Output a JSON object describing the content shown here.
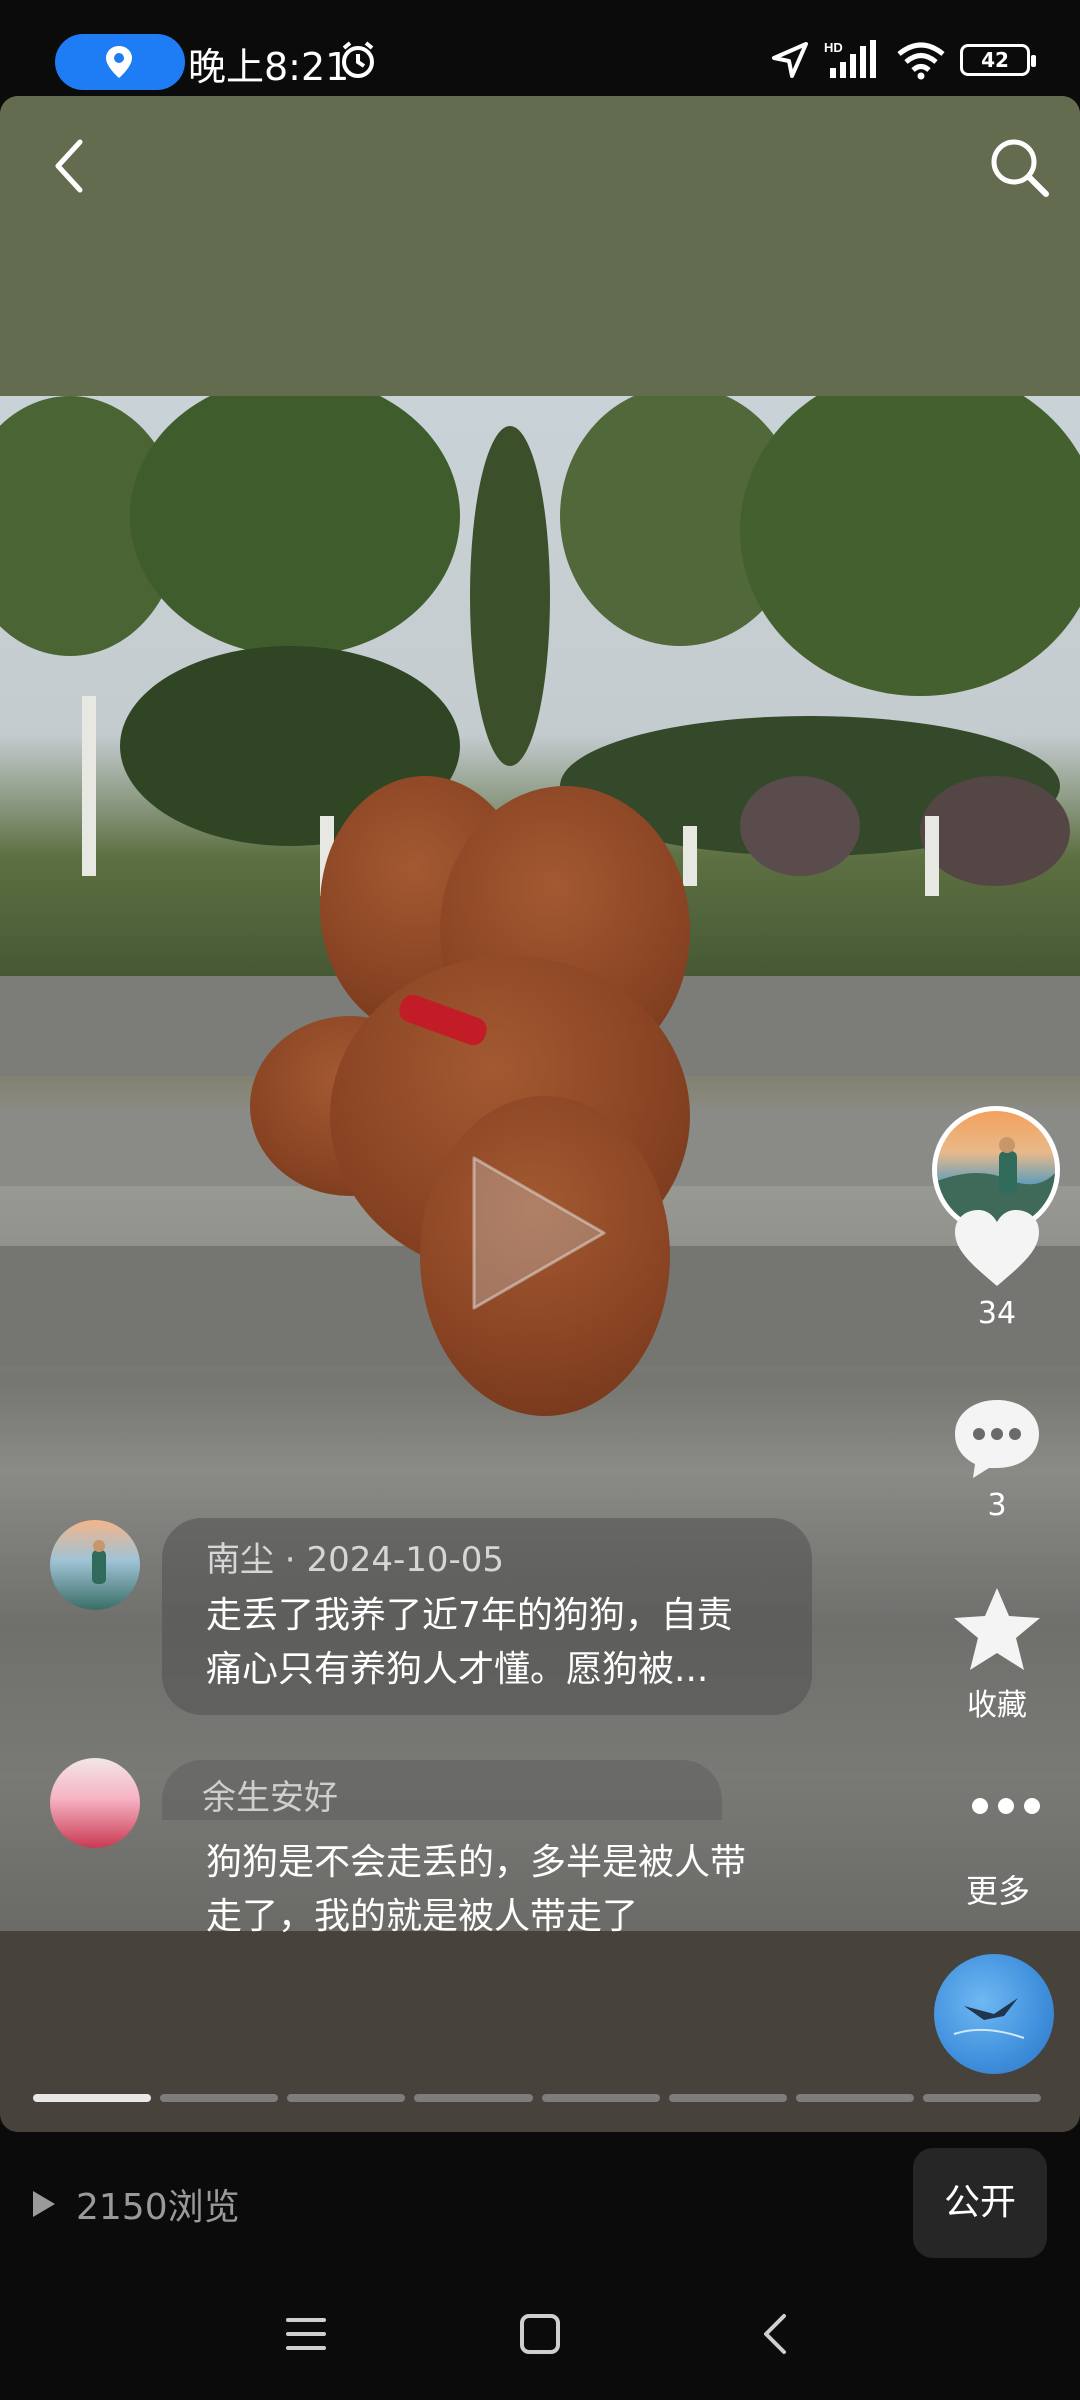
{
  "status_bar": {
    "time": "晚上8:21",
    "network": "HD",
    "battery": "42"
  },
  "post": {
    "author": "南尘",
    "date": "2024-10-05",
    "meta_separator": " · ",
    "text": "走丢了我养了近7年的狗狗，自责痛心只有养狗人才懂。愿狗被...",
    "likes": "34",
    "comments": "3",
    "favorite_label": "收藏",
    "more_label": "更多"
  },
  "comment": {
    "username": "余生安好",
    "text": "狗狗是不会走丢的，多半是被人带走了，我的就是被人带走了"
  },
  "progress": {
    "total": 8,
    "active_index": 0
  },
  "footer": {
    "views": "2150浏览",
    "visibility_button": "公开"
  },
  "colors": {
    "accent_blue": "#1e7cf5",
    "top_band": "#636c4f",
    "card_bottom": "#47423c"
  }
}
